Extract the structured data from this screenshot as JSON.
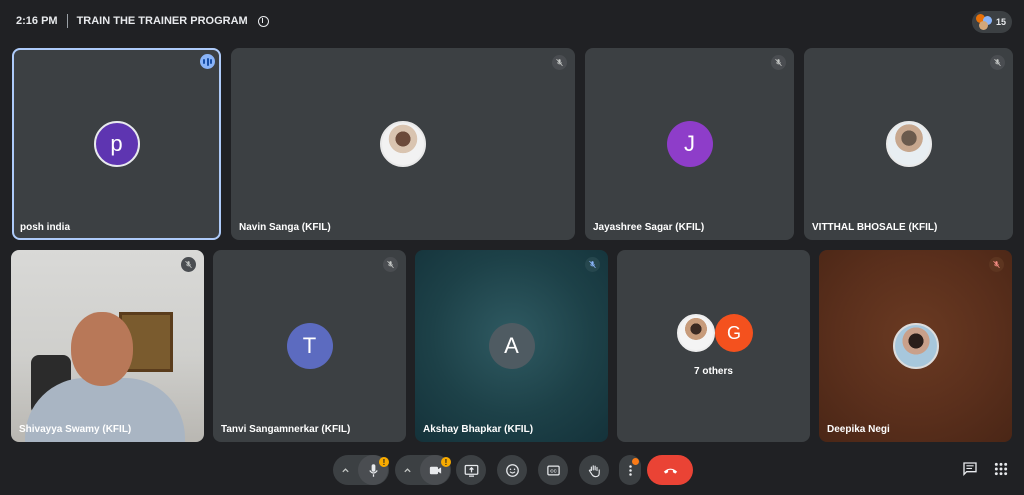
{
  "meeting": {
    "time": "2:16 PM",
    "title": "TRAIN THE TRAINER PROGRAM",
    "participant_count": "15"
  },
  "tiles": [
    {
      "name": "posh india",
      "initial": "p",
      "color": "#5e35b1"
    },
    {
      "name": "Navin Sanga (KFIL)"
    },
    {
      "name": "Jayashree Sagar (KFIL)",
      "initial": "J",
      "color": "#8e3dc9"
    },
    {
      "name": "VITTHAL BHOSALE (KFIL)"
    },
    {
      "name": "Shivayya Swamy (KFIL)"
    },
    {
      "name": "Tanvi Sangamnerkar (KFIL)",
      "initial": "T",
      "color": "#5c6bc0"
    },
    {
      "name": "Akshay Bhapkar (KFIL)",
      "initial": "A",
      "color": "#455a64"
    },
    {
      "name": "7 others",
      "initial": "G",
      "color": "#f4511e"
    },
    {
      "name": "Deepika Negi"
    }
  ],
  "colors": {
    "background": "#202124",
    "tile": "#3c4043",
    "end_call": "#ea4335",
    "active_border": "#aecbfa"
  }
}
